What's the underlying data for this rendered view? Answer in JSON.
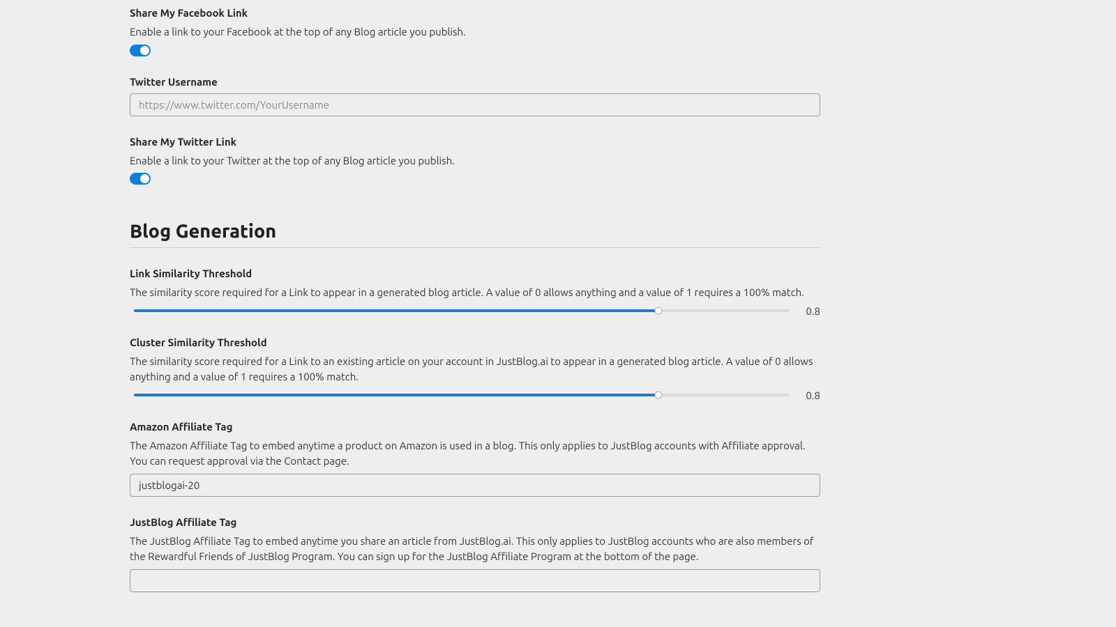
{
  "facebook_share": {
    "label": "Share My Facebook Link",
    "desc": "Enable a link to your Facebook at the top of any Blog article you publish.",
    "enabled": true
  },
  "twitter_username": {
    "label": "Twitter Username",
    "placeholder": "https://www.twitter.com/YourUsername",
    "value": ""
  },
  "twitter_share": {
    "label": "Share My Twitter Link",
    "desc": "Enable a link to your Twitter at the top of any Blog article you publish.",
    "enabled": true
  },
  "section_title": "Blog Generation",
  "link_similarity": {
    "label": "Link Similarity Threshold",
    "desc": "The similarity score required for a Link to appear in a generated blog article. A value of 0 allows anything and a value of 1 requires a 100% match.",
    "value": "0.8"
  },
  "cluster_similarity": {
    "label": "Cluster Similarity Threshold",
    "desc": "The similarity score required for a Link to an existing article on your account in JustBlog.ai to appear in a generated blog article. A value of 0 allows anything and a value of 1 requires a 100% match.",
    "value": "0.8"
  },
  "amazon_tag": {
    "label": "Amazon Affiliate Tag",
    "desc": "The Amazon Affiliate Tag to embed anytime a product on Amazon is used in a blog. This only applies to JustBlog accounts with Affiliate approval. You can request approval via the Contact page.",
    "value": "justblogai-20"
  },
  "justblog_tag": {
    "label": "JustBlog Affiliate Tag",
    "desc": "The JustBlog Affiliate Tag to embed anytime you share an article from JustBlog.ai. This only applies to JustBlog accounts who are also members of the Rewardful Friends of JustBlog Program. You can sign up for the JustBlog Affiliate Program at the bottom of the page.",
    "value": ""
  }
}
